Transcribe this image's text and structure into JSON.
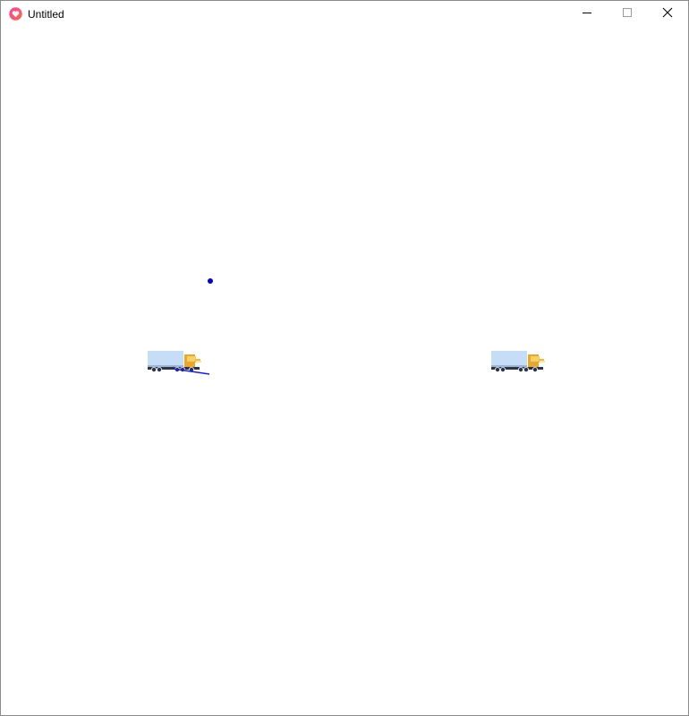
{
  "window": {
    "title": "Untitled",
    "app_icon": "heart-icon",
    "controls": {
      "minimize": "minimize-icon",
      "maximize": "maximize-icon",
      "close": "close-icon"
    }
  },
  "scene": {
    "sprites": [
      {
        "name": "truck-left",
        "icon": "truck-icon"
      },
      {
        "name": "truck-right",
        "icon": "truck-icon"
      },
      {
        "name": "projectile",
        "icon": "dot-icon"
      },
      {
        "name": "aim-line",
        "icon": "line-icon"
      }
    ],
    "colors": {
      "projectile": "#0000cc",
      "aim_line": "#1a1aff",
      "truck_cargo": "#c6ddf7",
      "truck_cab": "#f0b93a",
      "truck_chassis": "#2b3448"
    }
  }
}
